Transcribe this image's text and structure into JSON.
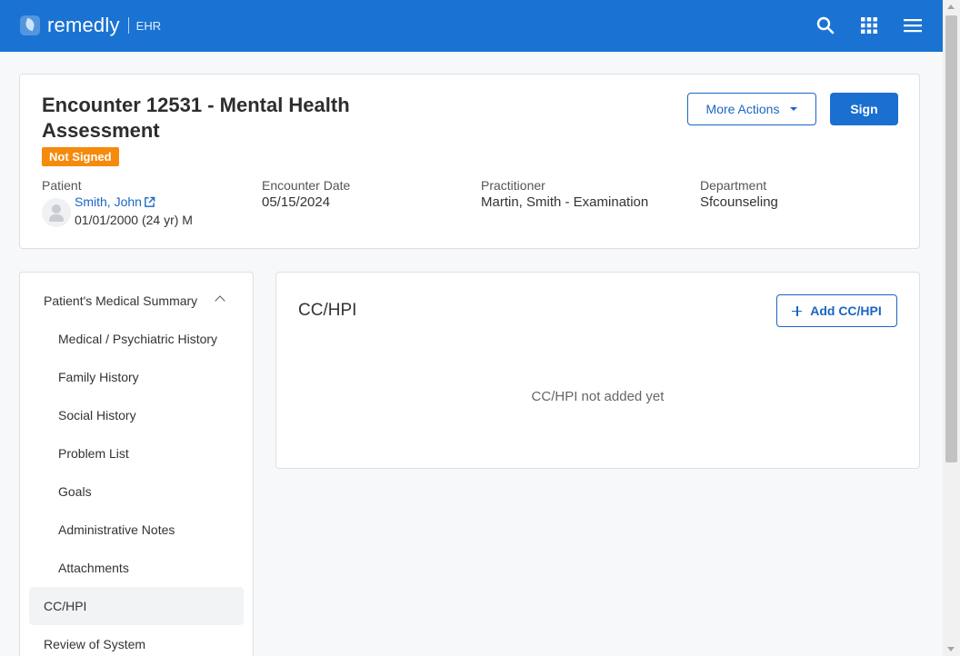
{
  "app": {
    "brand": "remedly",
    "product": "EHR",
    "icons": [
      "search-icon",
      "apps-grid-icon",
      "menu-icon"
    ]
  },
  "encounter": {
    "title": "Encounter 12531 - Mental Health Assessment",
    "status": "Not Signed",
    "more_actions_label": "More Actions",
    "sign_label": "Sign",
    "patient_label": "Patient",
    "patient_name": "Smith, John",
    "patient_dob": "01/01/2000 (24 yr) M",
    "date_label": "Encounter Date",
    "date_value": "05/15/2024",
    "practitioner_label": "Practitioner",
    "practitioner_value": "Martin, Smith - Examination",
    "department_label": "Department",
    "department_value": "Sfcounseling"
  },
  "sidebar": {
    "items": [
      {
        "label": "Patient's Medical Summary"
      },
      {
        "label": "Medical / Psychiatric History"
      },
      {
        "label": "Family History"
      },
      {
        "label": "Social History"
      },
      {
        "label": "Problem List"
      },
      {
        "label": "Goals"
      },
      {
        "label": "Administrative Notes"
      },
      {
        "label": "Attachments"
      },
      {
        "label": "CC/HPI"
      },
      {
        "label": "Review of System"
      }
    ]
  },
  "main": {
    "section_title": "CC/HPI",
    "add_label": "Add CC/HPI",
    "empty_text": "CC/HPI not added yet"
  },
  "colors": {
    "header": "#1a73d2",
    "primary": "#1a6fd1",
    "badge": "#f58a0b"
  }
}
